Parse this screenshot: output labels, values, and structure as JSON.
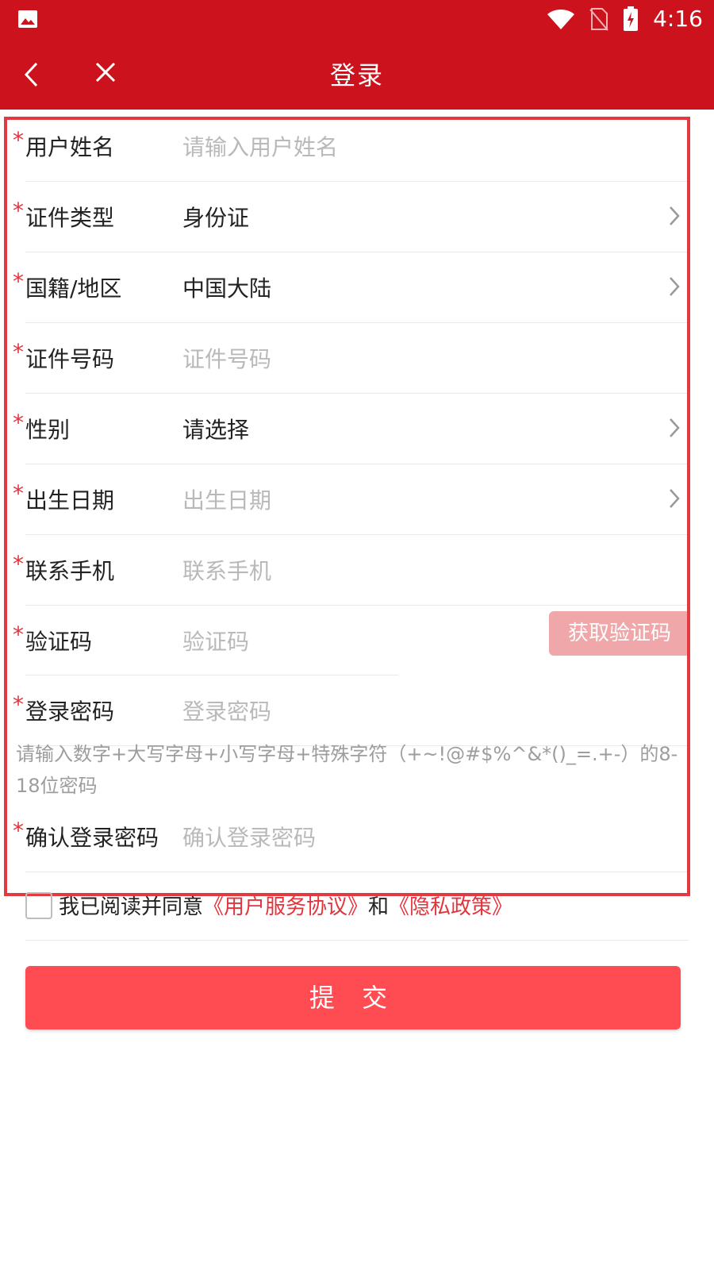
{
  "status_bar": {
    "time": "4:16",
    "icons": [
      "image-icon",
      "wifi-icon",
      "no-sim-icon",
      "battery-charging-icon"
    ]
  },
  "app_bar": {
    "title": "登录",
    "icons": [
      "back-arrow-icon",
      "close-icon"
    ]
  },
  "form": {
    "required_mark": "*",
    "fields": [
      {
        "label": "用户姓名",
        "placeholder": "请输入用户姓名"
      },
      {
        "label": "证件类型",
        "value": "身份证"
      },
      {
        "label": "国籍/地区",
        "value": "中国大陆"
      },
      {
        "label": "证件号码",
        "placeholder": "证件号码"
      },
      {
        "label": "性别",
        "value": "请选择"
      },
      {
        "label": "出生日期",
        "placeholder": "出生日期"
      },
      {
        "label": "联系手机",
        "placeholder": "联系手机"
      },
      {
        "label": "验证码",
        "placeholder": "验证码",
        "button": "获取验证码"
      },
      {
        "label": "登录密码",
        "placeholder": "登录密码"
      },
      {
        "label": "确认登录密码",
        "placeholder": "确认登录密码"
      }
    ],
    "password_hint": "请输入数字+大写字母+小写字母+特殊字符（+~!@#$%^&*()_=.+-）的8-18位密码"
  },
  "agreement": {
    "text_before": "我已阅读并同意",
    "link1": "《用户服务协议》",
    "middle": "和",
    "link2": "《隐私政策》"
  },
  "submit_label": "提 交",
  "colors": {
    "primary": "#cc131d",
    "button": "#ff4b52",
    "accent_red": "#e5333c",
    "disabled_button": "#f0a7a9"
  }
}
